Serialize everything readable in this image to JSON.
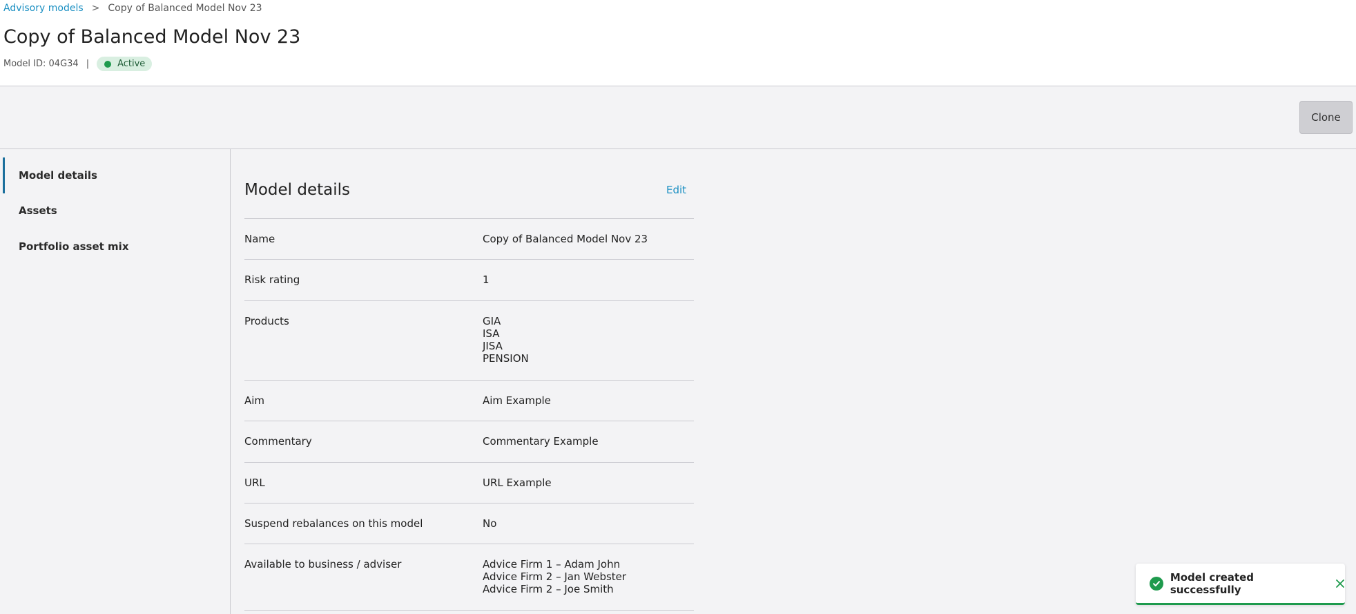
{
  "breadcrumb": {
    "parent": "Advisory models",
    "separator": ">",
    "current": "Copy of Balanced Model Nov 23"
  },
  "page": {
    "title": "Copy of Balanced Model Nov 23",
    "model_id": "Model ID: 04G34",
    "separator": "|",
    "status": "Active"
  },
  "actions": {
    "clone_label": "Clone"
  },
  "sidebar": {
    "items": [
      {
        "label": "Model details",
        "active": true
      },
      {
        "label": "Assets",
        "active": false
      },
      {
        "label": "Portfolio asset mix",
        "active": false
      }
    ]
  },
  "details": {
    "title": "Model details",
    "edit_label": "Edit",
    "rows": [
      {
        "label": "Name",
        "values": [
          "Copy of Balanced Model Nov 23"
        ]
      },
      {
        "label": "Risk rating",
        "values": [
          "1"
        ]
      },
      {
        "label": "Products",
        "values": [
          "GIA",
          "ISA",
          "JISA",
          "PENSION"
        ]
      },
      {
        "label": "Aim",
        "values": [
          "Aim Example"
        ]
      },
      {
        "label": "Commentary",
        "values": [
          "Commentary Example"
        ]
      },
      {
        "label": "URL",
        "values": [
          "URL Example"
        ]
      },
      {
        "label": "Suspend rebalances on this model",
        "values": [
          "No"
        ]
      },
      {
        "label": "Available to business / adviser",
        "values": [
          "Advice Firm 1 – Adam John",
          "Advice Firm 2 – Jan Webster",
          "Advice Firm 2 – Joe Smith"
        ]
      }
    ]
  },
  "toast": {
    "message": "Model created successfully",
    "icon": "check-circle-icon",
    "close_icon": "close-icon"
  },
  "colors": {
    "accent": "#1a8fc2",
    "success": "#1e9a4d",
    "active_nav": "#1a6f9c"
  }
}
